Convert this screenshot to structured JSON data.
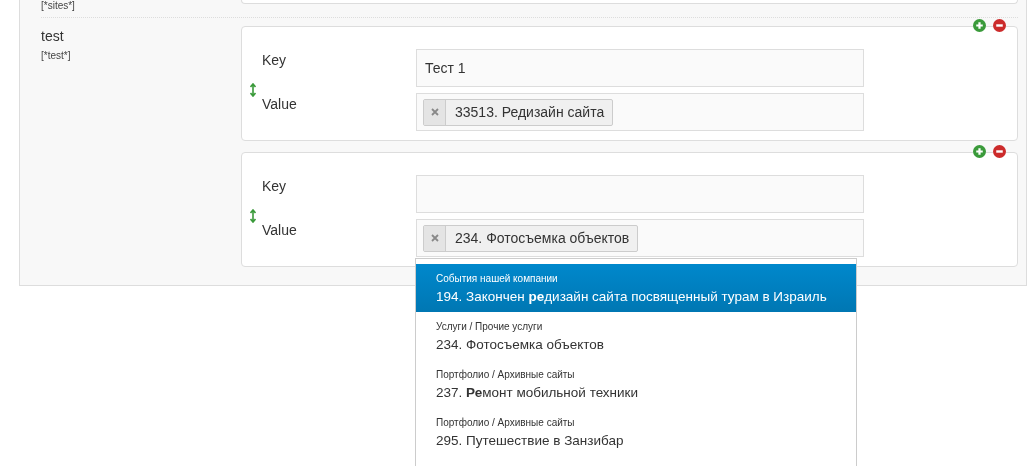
{
  "previous_field": {
    "tag": "[*sites*]"
  },
  "field": {
    "label": "test",
    "tag": "[*test*]",
    "pairs": [
      {
        "key_label": "Key",
        "key_value": "Тест 1",
        "value_label": "Value",
        "value_tag": "33513. Редизайн сайта"
      },
      {
        "key_label": "Key",
        "value_label": "Value",
        "value_tag": "234. Фотосъемка объектов"
      }
    ]
  },
  "dropdown": {
    "items": [
      {
        "category": "События нашей компании",
        "title": "194. Закончен **ре**дизайн сайта посвященный турам в Израиль",
        "selected": true
      },
      {
        "category": "Услуги / Прочие услуги",
        "title": "234. Фотосъемка объектов",
        "selected": false
      },
      {
        "category": "Портфолио / Архивные сайты",
        "title": "237. **Ре**монт мобильной техники",
        "selected": false
      },
      {
        "category": "Портфолио / Архивные сайты",
        "title": "295. Путешествие в Занзибар",
        "selected": false
      }
    ]
  }
}
